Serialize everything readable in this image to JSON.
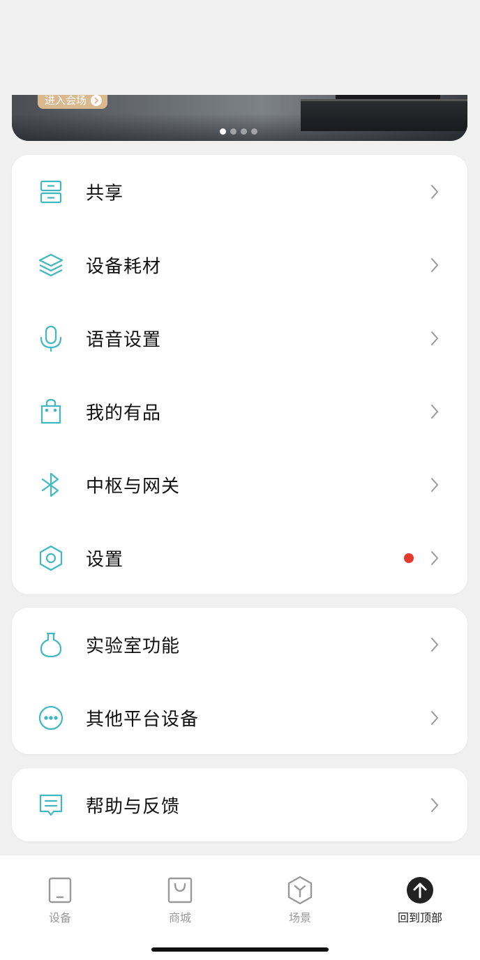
{
  "banner": {
    "enter_label": "进入会场",
    "dots_count": 4,
    "active_dot": 1
  },
  "menu_group_1": [
    {
      "label": "共享",
      "icon": "share-drawer-icon",
      "has_badge": false
    },
    {
      "label": "设备耗材",
      "icon": "layers-icon",
      "has_badge": false
    },
    {
      "label": "语音设置",
      "icon": "microphone-icon",
      "has_badge": false
    },
    {
      "label": "我的有品",
      "icon": "shopping-bag-icon",
      "has_badge": false
    },
    {
      "label": "中枢与网关",
      "icon": "bluetooth-icon",
      "has_badge": false
    },
    {
      "label": "设置",
      "icon": "hexagon-settings-icon",
      "has_badge": true
    }
  ],
  "menu_group_2": [
    {
      "label": "实验室功能",
      "icon": "flask-icon"
    },
    {
      "label": "其他平台设备",
      "icon": "more-dots-icon"
    }
  ],
  "menu_group_3": [
    {
      "label": "帮助与反馈",
      "icon": "feedback-message-icon"
    }
  ],
  "tabbar": {
    "tabs": [
      {
        "label": "设备",
        "icon": "device-icon",
        "active": false
      },
      {
        "label": "商城",
        "icon": "shop-bag-icon",
        "active": false
      },
      {
        "label": "场景",
        "icon": "scene-cube-icon",
        "active": false
      },
      {
        "label": "回到顶部",
        "icon": "back-to-top-icon",
        "active": true
      }
    ]
  },
  "colors": {
    "accent": "#3fb8c0",
    "badge": "#e9392d",
    "background": "#f0f0f0"
  }
}
